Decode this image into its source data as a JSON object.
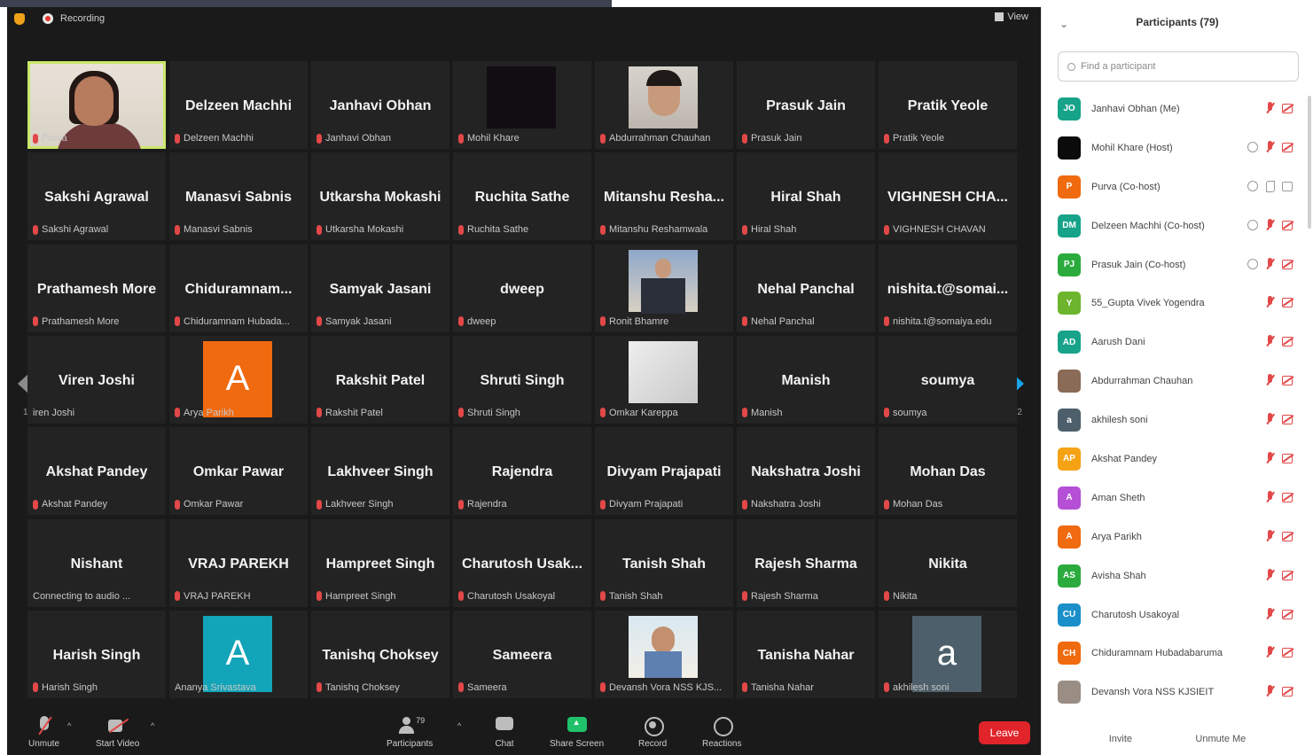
{
  "topbar": {
    "recording_label": "Recording",
    "view_label": "View"
  },
  "grid": {
    "page_indicator_left": "1/2",
    "page_indicator_right": "1/2",
    "tiles": [
      {
        "name": "",
        "label": "Purva",
        "video": "self"
      },
      {
        "name": "Delzeen Machhi",
        "label": "Delzeen Machhi"
      },
      {
        "name": "Janhavi Obhan",
        "label": "Janhavi Obhan"
      },
      {
        "name": "",
        "label": "Mohil Khare",
        "video": "dark"
      },
      {
        "name": "",
        "label": "Abdurrahman Chauhan",
        "video": "photo-man"
      },
      {
        "name": "Prasuk Jain",
        "label": "Prasuk Jain"
      },
      {
        "name": "Pratik Yeole",
        "label": "Pratik Yeole"
      },
      {
        "name": "Sakshi Agrawal",
        "label": "Sakshi Agrawal"
      },
      {
        "name": "Manasvi Sabnis",
        "label": "Manasvi Sabnis"
      },
      {
        "name": "Utkarsha Mokashi",
        "label": "Utkarsha Mokashi"
      },
      {
        "name": "Ruchita Sathe",
        "label": "Ruchita Sathe"
      },
      {
        "name": "Mitanshu Resha...",
        "label": "Mitanshu Reshamwala"
      },
      {
        "name": "Hiral Shah",
        "label": "Hiral Shah"
      },
      {
        "name": "VIGHNESH CHA...",
        "label": "VIGHNESH CHAVAN"
      },
      {
        "name": "Prathamesh More",
        "label": "Prathamesh More"
      },
      {
        "name": "Chiduramnam...",
        "label": "Chiduramnam Hubada..."
      },
      {
        "name": "Samyak Jasani",
        "label": "Samyak Jasani"
      },
      {
        "name": "dweep",
        "label": "dweep"
      },
      {
        "name": "",
        "label": "Ronit Bhamre",
        "video": "photo-suit"
      },
      {
        "name": "Nehal Panchal",
        "label": "Nehal Panchal"
      },
      {
        "name": "nishita.t@somai...",
        "label": "nishita.t@somaiya.edu"
      },
      {
        "name": "Viren Joshi",
        "label": "iren Joshi",
        "nomic": true
      },
      {
        "name": "",
        "label": "Arya Parikh",
        "avatar": "A",
        "avatar_class": "av-orange"
      },
      {
        "name": "Rakshit Patel",
        "label": "Rakshit Patel"
      },
      {
        "name": "Shruti Singh",
        "label": "Shruti Singh"
      },
      {
        "name": "",
        "label": "Omkar Kareppa",
        "video": "photo-white"
      },
      {
        "name": "Manish",
        "label": "Manish"
      },
      {
        "name": "soumya",
        "label": "soumya"
      },
      {
        "name": "Akshat Pandey",
        "label": "Akshat Pandey"
      },
      {
        "name": "Omkar Pawar",
        "label": "Omkar Pawar"
      },
      {
        "name": "Lakhveer Singh",
        "label": "Lakhveer Singh"
      },
      {
        "name": "Rajendra",
        "label": "Rajendra"
      },
      {
        "name": "Divyam Prajapati",
        "label": "Divyam Prajapati"
      },
      {
        "name": "Nakshatra Joshi",
        "label": "Nakshatra Joshi"
      },
      {
        "name": "Mohan Das",
        "label": "Mohan Das"
      },
      {
        "name": "Nishant",
        "label": "Connecting to audio ...",
        "nomic": true
      },
      {
        "name": "VRAJ PAREKH",
        "label": "VRAJ PAREKH"
      },
      {
        "name": "Hampreet Singh",
        "label": "Hampreet Singh"
      },
      {
        "name": "Charutosh Usak...",
        "label": "Charutosh Usakoyal"
      },
      {
        "name": "Tanish Shah",
        "label": "Tanish Shah"
      },
      {
        "name": "Rajesh Sharma",
        "label": "Rajesh Sharma"
      },
      {
        "name": "Nikita",
        "label": "Nikita"
      },
      {
        "name": "Harish Singh",
        "label": "Harish Singh"
      },
      {
        "name": "",
        "label": "Ananya Srivastava",
        "avatar": "A",
        "avatar_class": "av-teal",
        "nomic": true
      },
      {
        "name": "Tanishq Choksey",
        "label": "Tanishq Choksey"
      },
      {
        "name": "Sameera",
        "label": "Sameera"
      },
      {
        "name": "",
        "label": "Devansh Vora NSS KJS...",
        "video": "photo-kid"
      },
      {
        "name": "Tanisha Nahar",
        "label": "Tanisha Nahar"
      },
      {
        "name": "",
        "label": "akhilesh soni",
        "avatar": "a",
        "avatar_class": "av-slate"
      }
    ]
  },
  "toolbar": {
    "unmute": "Unmute",
    "start_video": "Start Video",
    "participants": "Participants",
    "participants_count": "79",
    "chat": "Chat",
    "share_screen": "Share Screen",
    "record": "Record",
    "reactions": "Reactions",
    "leave": "Leave"
  },
  "panel": {
    "title": "Participants (79)",
    "search_placeholder": "Find a participant",
    "invite": "Invite",
    "unmute_me": "Unmute Me",
    "participants": [
      {
        "initials": "JO",
        "color": "#17a38a",
        "name": "Janhavi Obhan (Me)",
        "status": [
          "mic",
          "cam"
        ]
      },
      {
        "initials": "",
        "color": "#0b0b0b",
        "name": "Mohil Khare (Host)",
        "status": [
          "share",
          "mic",
          "cam"
        ]
      },
      {
        "initials": "P",
        "color": "#f06a0f",
        "name": "Purva (Co-host)",
        "status": [
          "share",
          "phone",
          "camgrey"
        ]
      },
      {
        "initials": "DM",
        "color": "#17a38a",
        "name": "Delzeen Machhi (Co-host)",
        "status": [
          "share",
          "mic",
          "cam"
        ]
      },
      {
        "initials": "PJ",
        "color": "#2bab3d",
        "name": "Prasuk Jain (Co-host)",
        "status": [
          "share",
          "mic",
          "cam"
        ]
      },
      {
        "initials": "Y",
        "color": "#6cb52d",
        "name": "55_Gupta Vivek Yogendra",
        "status": [
          "mic",
          "cam"
        ]
      },
      {
        "initials": "AD",
        "color": "#17a38a",
        "name": "Aarush Dani",
        "status": [
          "mic",
          "cam"
        ]
      },
      {
        "initials": "",
        "color": "#8a6b57",
        "name": "Abdurrahman Chauhan",
        "status": [
          "mic",
          "cam"
        ]
      },
      {
        "initials": "a",
        "color": "#4d5f6b",
        "name": "akhilesh soni",
        "status": [
          "mic",
          "cam"
        ]
      },
      {
        "initials": "AP",
        "color": "#f5a214",
        "name": "Akshat Pandey",
        "status": [
          "mic",
          "cam"
        ]
      },
      {
        "initials": "A",
        "color": "#b44fd6",
        "name": "Aman Sheth",
        "status": [
          "mic",
          "cam"
        ]
      },
      {
        "initials": "A",
        "color": "#f06a0f",
        "name": "Arya Parikh",
        "status": [
          "mic",
          "cam"
        ]
      },
      {
        "initials": "AS",
        "color": "#2bab3d",
        "name": "Avisha Shah",
        "status": [
          "mic",
          "cam"
        ]
      },
      {
        "initials": "CU",
        "color": "#1a8fc9",
        "name": "Charutosh Usakoyal",
        "status": [
          "mic",
          "cam"
        ]
      },
      {
        "initials": "CH",
        "color": "#f06a0f",
        "name": "Chiduramnam Hubadabaruma",
        "status": [
          "mic",
          "cam"
        ]
      },
      {
        "initials": "",
        "color": "#9a8d84",
        "name": "Devansh Vora NSS KJSIEIT",
        "status": [
          "mic",
          "cam"
        ]
      }
    ]
  }
}
